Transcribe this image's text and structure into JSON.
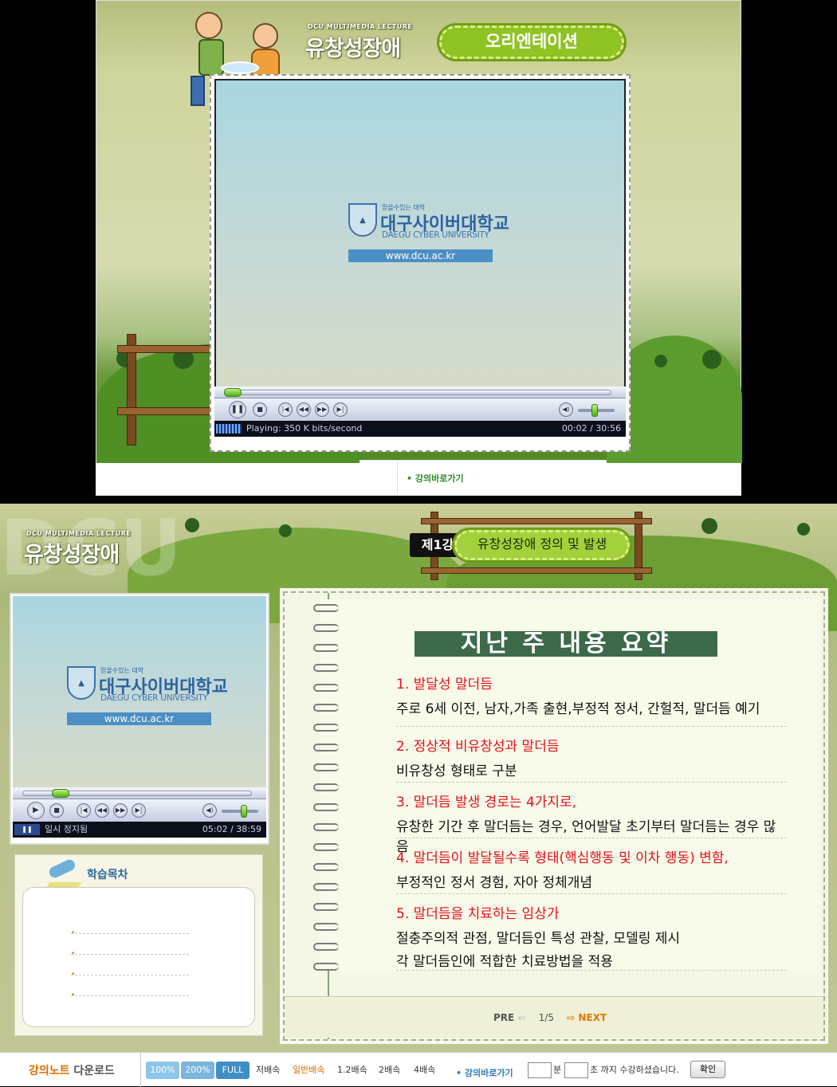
{
  "top": {
    "brand_small": "DCU MULTIMEDIA LECTURE",
    "course_title": "유창성장애",
    "section_badge": "오리엔테이션",
    "player": {
      "logo_slogan": "믿을수있는 대학",
      "logo_kr": "대구사이버대학교",
      "logo_en": "DAEGU CYBER UNIVERSITY",
      "logo_url": "www.dcu.ac.kr",
      "status_text": "Playing: 350 K bits/second",
      "time_text": "00:02 / 30:56",
      "progress_fraction": 0.001
    },
    "lecture_link": "강의바로가기"
  },
  "bottom": {
    "brand_small": "DCU MULTIMEDIA LECTURE",
    "course_title": "유창성장애",
    "lecture_number": "제1강",
    "lecture_title": "유창성장애 정의 및 발생",
    "player": {
      "logo_slogan": "믿을수있는 대학",
      "logo_kr": "대구사이버대학교",
      "logo_en": "DAEGU CYBER UNIVERSITY",
      "logo_url": "www.dcu.ac.kr",
      "status_text": "일시 정지됨",
      "time_text": "05:02 / 38:59",
      "progress_fraction": 0.13
    },
    "toc_title": "학습목차",
    "summary": {
      "title": "지난 주 내용 요약",
      "items": [
        {
          "heading": "1. 발달성 말더듬",
          "lines": [
            "주로 6세 이전, 남자,가족 출현,부정적 정서, 간헐적, 말더듬 예기"
          ]
        },
        {
          "heading": "2. 정상적 비유창성과 말더듬",
          "lines": [
            "비유창성 형태로 구분"
          ]
        },
        {
          "heading": "3. 말더듬 발생 경로는 4가지로,",
          "lines": [
            "유창한 기간 후 말더듬는 경우, 언어발달 초기부터 말더듬는 경우 많음"
          ]
        },
        {
          "heading": "4. 말더듬이 발달될수록 형태(핵심행동 및 이차 행동) 변함,",
          "lines": [
            "부정적인 정서 경험, 자아 정체개념"
          ]
        },
        {
          "heading": "5. 말더듬을 치료하는 임상가",
          "lines": [
            "절충주의적 관점, 말더듬인 특성 관찰, 모델링 제시",
            "각 말더듬인에 적합한 치료방법을 적용"
          ]
        }
      ]
    },
    "pager": {
      "prev": "PRE",
      "page": "1/5",
      "next": "NEXT"
    },
    "footer": {
      "note_download_1": "강의노트",
      "note_download_2": "다운로드",
      "zoom_100": "100%",
      "zoom_200": "200%",
      "zoom_full": "FULL",
      "speed_low": "저배속",
      "speed_normal": "일반배속",
      "speed_12": "1.2배속",
      "speed_2": "2배속",
      "speed_4": "4배속",
      "lecture_link": "강의바로가기",
      "minute_label": "분",
      "second_label": "초 까지 수강하셨습니다.",
      "confirm": "확인"
    }
  },
  "colors": {
    "accent_green": "#8fc323",
    "note_green": "#3c6a4a",
    "red_heading": "#e2111b",
    "footer_orange": "#e06a00"
  }
}
